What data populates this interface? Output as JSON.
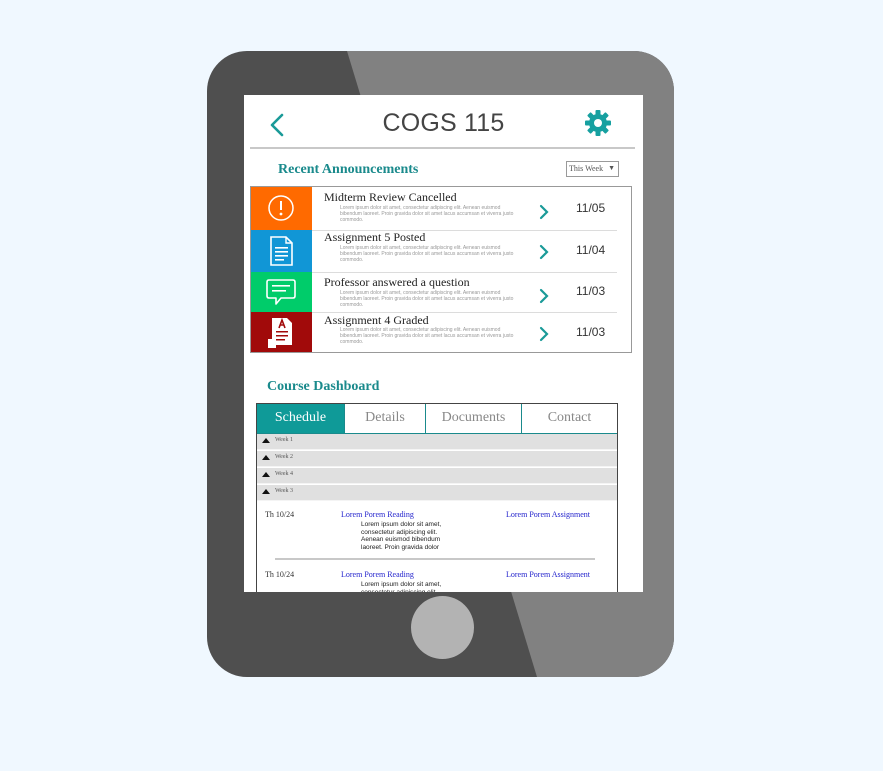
{
  "app": {
    "title": "COGS 115"
  },
  "announcements": {
    "heading": "Recent Announcements",
    "filter": {
      "selected": "This Week"
    },
    "items": [
      {
        "title": "Midterm Review Cancelled",
        "body": "Lorem ipsum dolor sit amet, consectetur adipiscing elit. Aenean euismod bibendum laoreet. Proin gravida dolor sit amet lacus accumsan et viverra justo commodo.",
        "date": "11/05",
        "icon": "alert-icon",
        "color": "#ff6a00"
      },
      {
        "title": "Assignment 5 Posted",
        "body": "Lorem ipsum dolor sit amet, consectetur adipiscing elit. Aenean euismod bibendum laoreet. Proin gravida dolor sit amet lacus accumsan et viverra justo commodo.",
        "date": "11/04",
        "icon": "document-icon",
        "color": "#1196d6"
      },
      {
        "title": "Professor answered a question",
        "body": "Lorem ipsum dolor sit amet, consectetur adipiscing elit. Aenean euismod bibendum laoreet. Proin gravida dolor sit amet lacus accumsan et viverra justo commodo.",
        "date": "11/03",
        "icon": "chat-icon",
        "color": "#00cc6a"
      },
      {
        "title": "Assignment 4 Graded",
        "body": "Lorem ipsum dolor sit amet, consectetur adipiscing elit. Aenean euismod bibendum laoreet. Proin gravida dolor sit amet lacus accumsan et viverra justo commodo.",
        "date": "11/03",
        "icon": "graded-document-icon",
        "color": "#a10a0a"
      }
    ]
  },
  "dashboard": {
    "heading": "Course Dashboard",
    "tabs": [
      "Schedule",
      "Details",
      "Documents",
      "Contact"
    ],
    "active_tab": "Schedule",
    "weeks": [
      "Week 1",
      "Week 2",
      "Week 4",
      "Week 3"
    ],
    "entries": [
      {
        "date": "Th 10/24",
        "reading": "Lorem Porem Reading",
        "assignment": "Lorem Porem Assignment",
        "description": "Lorem ipsum dolor sit amet, consectetur adipiscing elit. Aenean euismod bibendum laoreet. Proin gravida dolor"
      },
      {
        "date": "Th 10/24",
        "reading": "Lorem Porem Reading",
        "assignment": "Lorem Porem Assignment",
        "description": "Lorem ipsum dolor sit amet, consectetur adipiscing elit."
      }
    ]
  },
  "colors": {
    "accent": "#1a8a8c",
    "tab_active": "#0f9a98",
    "tablet_dark": "#4f4f4f",
    "tablet_light": "#818181",
    "background": "#f0f8ff"
  }
}
